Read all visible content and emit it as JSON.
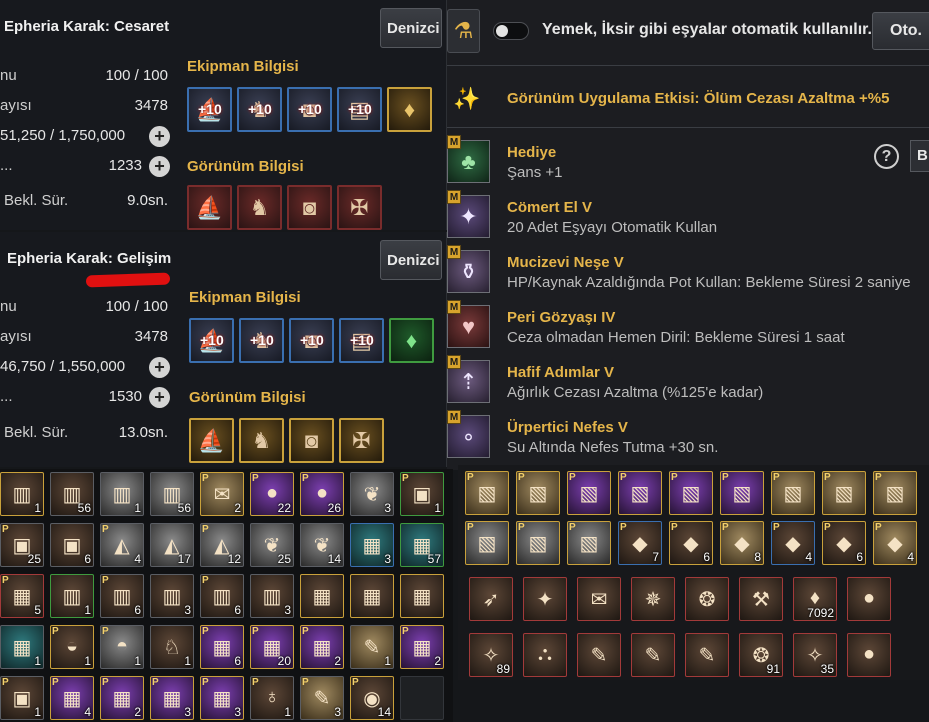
{
  "ships": [
    {
      "title": "Epheria Karak: Cesaret",
      "button_label": "Denizci",
      "stats": [
        {
          "label": "nu",
          "value": "100 / 100",
          "has_plus": false
        },
        {
          "label": "ayısı",
          "value": "3478",
          "has_plus": false
        },
        {
          "label": "",
          "value": "51,250 / 1,750,000",
          "has_plus": true
        },
        {
          "label": "...",
          "value": "1233",
          "has_plus": true
        },
        {
          "label": "Bekl. Sür.",
          "value": "9.0sn.",
          "has_plus": false
        }
      ],
      "equipment_title": "Ekipman Bilgisi",
      "equipment": [
        {
          "icon": "bow-icon",
          "enh": "+10"
        },
        {
          "icon": "figurehead-icon",
          "enh": "+10"
        },
        {
          "icon": "cannon-icon",
          "enh": "+10"
        },
        {
          "icon": "plating-icon",
          "enh": "+10"
        },
        {
          "icon": "crystal-icon",
          "enh": ""
        }
      ],
      "appearance_title": "Görünüm Bilgisi",
      "appearance": [
        "bow-icon",
        "figurehead-icon",
        "cannon-icon",
        "sail-icon"
      ]
    },
    {
      "title": "Epheria Karak: Gelişim",
      "button_label": "Denizci",
      "stats": [
        {
          "label": "nu",
          "value": "100 / 100",
          "has_plus": false
        },
        {
          "label": "ayısı",
          "value": "3478",
          "has_plus": false
        },
        {
          "label": "",
          "value": "46,750 / 1,550,000",
          "has_plus": true
        },
        {
          "label": "...",
          "value": "1530",
          "has_plus": true
        },
        {
          "label": "Bekl. Sür.",
          "value": "13.0sn.",
          "has_plus": false
        }
      ],
      "equipment_title": "Ekipman Bilgisi",
      "equipment": [
        {
          "icon": "bow-icon",
          "enh": "+10"
        },
        {
          "icon": "figurehead-icon",
          "enh": "+10"
        },
        {
          "icon": "cannon-icon",
          "enh": "+10"
        },
        {
          "icon": "plating-icon",
          "enh": "+10"
        },
        {
          "icon": "crystal-icon",
          "enh": ""
        }
      ],
      "appearance_title": "Görünüm Bilgisi",
      "appearance": [
        "bow-icon",
        "figurehead-icon",
        "cannon-icon",
        "sail-icon"
      ]
    }
  ],
  "auto_use": {
    "text": "Yemek, İksir gibi eşyalar otomatik kullanılır.",
    "button_label": "Oto. D",
    "enabled": false
  },
  "appearance_effect": "Görünüm Uygulama Etkisi: Ölüm Cezası Azaltma +%5",
  "buffs": [
    {
      "name": "Hediye",
      "desc": "Şans +1",
      "icon": "clover-icon",
      "badge": "M"
    },
    {
      "name": "Cömert El V",
      "desc": "20 Adet Eşyayı Otomatik Kullan",
      "icon": "fairy-icon",
      "badge": "M"
    },
    {
      "name": "Mucizevi Neşe V",
      "desc": "HP/Kaynak Azaldığında Pot Kullan: Bekleme Süresi 2 saniye",
      "icon": "potion-icon",
      "badge": "M"
    },
    {
      "name": "Peri Gözyaşı IV",
      "desc": "Ceza olmadan Hemen Diril: Bekleme Süresi 1 saat",
      "icon": "tear-icon",
      "badge": "M"
    },
    {
      "name": "Hafif Adımlar V",
      "desc": "Ağırlık Cezası Azaltma (%125'e kadar)",
      "icon": "weight-icon",
      "badge": "M"
    },
    {
      "name": "Ürpertici Nefes V",
      "desc": "Su Altında Nefes Tutma +30 sn.",
      "icon": "bubble-icon",
      "badge": "M"
    }
  ],
  "help_label": "?",
  "side_button_label": "B",
  "left_inventory": [
    {
      "c": "1",
      "p": false,
      "t": "",
      "b": "gold",
      "i": "book-icon"
    },
    {
      "c": "56",
      "p": false,
      "t": "",
      "b": "",
      "i": "book-icon"
    },
    {
      "c": "1",
      "p": false,
      "t": "silver",
      "b": "",
      "i": "book-icon"
    },
    {
      "c": "56",
      "p": false,
      "t": "silver",
      "b": "",
      "i": "book-icon"
    },
    {
      "c": "2",
      "p": true,
      "t": "scroll",
      "b": "gold",
      "i": "map-icon"
    },
    {
      "c": "22",
      "p": true,
      "t": "purple",
      "b": "gold",
      "i": "orb-icon"
    },
    {
      "c": "26",
      "p": true,
      "t": "purple",
      "b": "gold",
      "i": "orb-icon"
    },
    {
      "c": "3",
      "p": false,
      "t": "silver",
      "b": "",
      "i": "tree-icon"
    },
    {
      "c": "1",
      "p": true,
      "t": "",
      "b": "green",
      "i": "pack-icon"
    },
    {
      "c": "25",
      "p": true,
      "t": "",
      "b": "",
      "i": "pack-icon"
    },
    {
      "c": "6",
      "p": false,
      "t": "",
      "b": "",
      "i": "pack-icon"
    },
    {
      "c": "4",
      "p": true,
      "t": "silver",
      "b": "",
      "i": "horn-icon"
    },
    {
      "c": "17",
      "p": false,
      "t": "silver",
      "b": "",
      "i": "horn-icon"
    },
    {
      "c": "12",
      "p": true,
      "t": "silver",
      "b": "",
      "i": "horn-icon"
    },
    {
      "c": "25",
      "p": false,
      "t": "silver",
      "b": "",
      "i": "tree-icon"
    },
    {
      "c": "14",
      "p": false,
      "t": "silver",
      "b": "",
      "i": "tree-icon"
    },
    {
      "c": "3",
      "p": false,
      "t": "teal",
      "b": "blue",
      "i": "chest-icon"
    },
    {
      "c": "57",
      "p": false,
      "t": "teal",
      "b": "green",
      "i": "chest-icon"
    },
    {
      "c": "5",
      "p": true,
      "t": "",
      "b": "red",
      "i": "chest-icon"
    },
    {
      "c": "1",
      "p": false,
      "t": "",
      "b": "green",
      "i": "book-icon"
    },
    {
      "c": "6",
      "p": true,
      "t": "",
      "b": "",
      "i": "book-icon"
    },
    {
      "c": "3",
      "p": false,
      "t": "",
      "b": "",
      "i": "book-icon"
    },
    {
      "c": "6",
      "p": true,
      "t": "",
      "b": "",
      "i": "book-icon"
    },
    {
      "c": "3",
      "p": false,
      "t": "",
      "b": "",
      "i": "book-icon"
    },
    {
      "c": "",
      "p": false,
      "t": "",
      "b": "gold",
      "i": "chest-icon"
    },
    {
      "c": "",
      "p": false,
      "t": "",
      "b": "gold",
      "i": "chest-icon"
    },
    {
      "c": "",
      "p": false,
      "t": "",
      "b": "gold",
      "i": "chest-icon"
    },
    {
      "c": "1",
      "p": false,
      "t": "teal",
      "b": "",
      "i": "chest-icon"
    },
    {
      "c": "1",
      "p": true,
      "t": "",
      "b": "gold",
      "i": "bag-icon"
    },
    {
      "c": "1",
      "p": true,
      "t": "silver",
      "b": "",
      "i": "helm-icon"
    },
    {
      "c": "1",
      "p": false,
      "t": "",
      "b": "",
      "i": "dragon-icon"
    },
    {
      "c": "6",
      "p": true,
      "t": "purple",
      "b": "gold",
      "i": "chest-icon"
    },
    {
      "c": "20",
      "p": true,
      "t": "purple",
      "b": "gold",
      "i": "chest-icon"
    },
    {
      "c": "2",
      "p": true,
      "t": "purple",
      "b": "gold",
      "i": "chest-icon"
    },
    {
      "c": "1",
      "p": false,
      "t": "scroll",
      "b": "",
      "i": "scroll-icon"
    },
    {
      "c": "2",
      "p": true,
      "t": "purple",
      "b": "gold",
      "i": "chest-icon"
    },
    {
      "c": "1",
      "p": true,
      "t": "",
      "b": "",
      "i": "pack-icon"
    },
    {
      "c": "4",
      "p": true,
      "t": "purple",
      "b": "gold",
      "i": "chest-icon"
    },
    {
      "c": "2",
      "p": true,
      "t": "purple",
      "b": "gold",
      "i": "chest-icon"
    },
    {
      "c": "3",
      "p": true,
      "t": "purple",
      "b": "gold",
      "i": "chest-icon"
    },
    {
      "c": "3",
      "p": true,
      "t": "purple",
      "b": "gold",
      "i": "chest-icon"
    },
    {
      "c": "1",
      "p": true,
      "t": "",
      "b": "",
      "i": "potion-icon"
    },
    {
      "c": "3",
      "p": true,
      "t": "scroll",
      "b": "",
      "i": "scroll-icon"
    },
    {
      "c": "14",
      "p": true,
      "t": "",
      "b": "gold",
      "i": "medal-icon"
    },
    {
      "c": "",
      "p": false,
      "t": "empty",
      "b": "",
      "i": ""
    }
  ],
  "right_inventory": [
    {
      "c": "",
      "p": true,
      "t": "scroll",
      "b": "gold",
      "i": "paper-icon"
    },
    {
      "c": "",
      "p": true,
      "t": "scroll",
      "b": "gold",
      "i": "paper-icon"
    },
    {
      "c": "",
      "p": true,
      "t": "purple",
      "b": "gold",
      "i": "paper-icon"
    },
    {
      "c": "",
      "p": true,
      "t": "purple",
      "b": "gold",
      "i": "paper-icon"
    },
    {
      "c": "",
      "p": true,
      "t": "purple",
      "b": "gold",
      "i": "paper-icon"
    },
    {
      "c": "",
      "p": true,
      "t": "purple",
      "b": "gold",
      "i": "paper-icon"
    },
    {
      "c": "",
      "p": true,
      "t": "scroll",
      "b": "gold",
      "i": "paper-icon"
    },
    {
      "c": "",
      "p": true,
      "t": "scroll",
      "b": "gold",
      "i": "paper-icon"
    },
    {
      "c": "",
      "p": true,
      "t": "scroll",
      "b": "gold",
      "i": "paper-icon"
    },
    {
      "c": "",
      "p": true,
      "t": "silver",
      "b": "gold",
      "i": "paper-icon"
    },
    {
      "c": "",
      "p": true,
      "t": "silver",
      "b": "gold",
      "i": "paper-icon"
    },
    {
      "c": "",
      "p": true,
      "t": "silver",
      "b": "gold",
      "i": "paper-icon"
    },
    {
      "c": "7",
      "p": true,
      "t": "",
      "b": "blue",
      "i": "card-icon"
    },
    {
      "c": "6",
      "p": true,
      "t": "",
      "b": "gold",
      "i": "card-icon"
    },
    {
      "c": "8",
      "p": true,
      "t": "scroll",
      "b": "gold",
      "i": "card-icon"
    },
    {
      "c": "4",
      "p": true,
      "t": "",
      "b": "blue",
      "i": "card-icon"
    },
    {
      "c": "6",
      "p": true,
      "t": "",
      "b": "gold",
      "i": "card-icon"
    },
    {
      "c": "4",
      "p": true,
      "t": "scroll",
      "b": "gold",
      "i": "card-icon"
    }
  ],
  "consumables": [
    {
      "c": "",
      "i": "harpoon-icon"
    },
    {
      "c": "",
      "i": "fairy-icon"
    },
    {
      "c": "",
      "i": "map-icon"
    },
    {
      "c": "",
      "i": "compass-icon"
    },
    {
      "c": "",
      "i": "amulet-icon"
    },
    {
      "c": "",
      "i": "axe-icon"
    },
    {
      "c": "7092",
      "i": "gem-icon"
    },
    {
      "c": "",
      "i": "orb-icon"
    },
    {
      "c": "89",
      "i": "crystal-icon"
    },
    {
      "c": "",
      "i": "locked-icon"
    },
    {
      "c": "",
      "i": "scroll-icon"
    },
    {
      "c": "",
      "i": "scroll-icon"
    },
    {
      "c": "",
      "i": "scroll-icon"
    },
    {
      "c": "91",
      "i": "amulet-icon"
    },
    {
      "c": "35",
      "i": "crystal-icon"
    },
    {
      "c": "",
      "i": "orb-icon"
    }
  ]
}
